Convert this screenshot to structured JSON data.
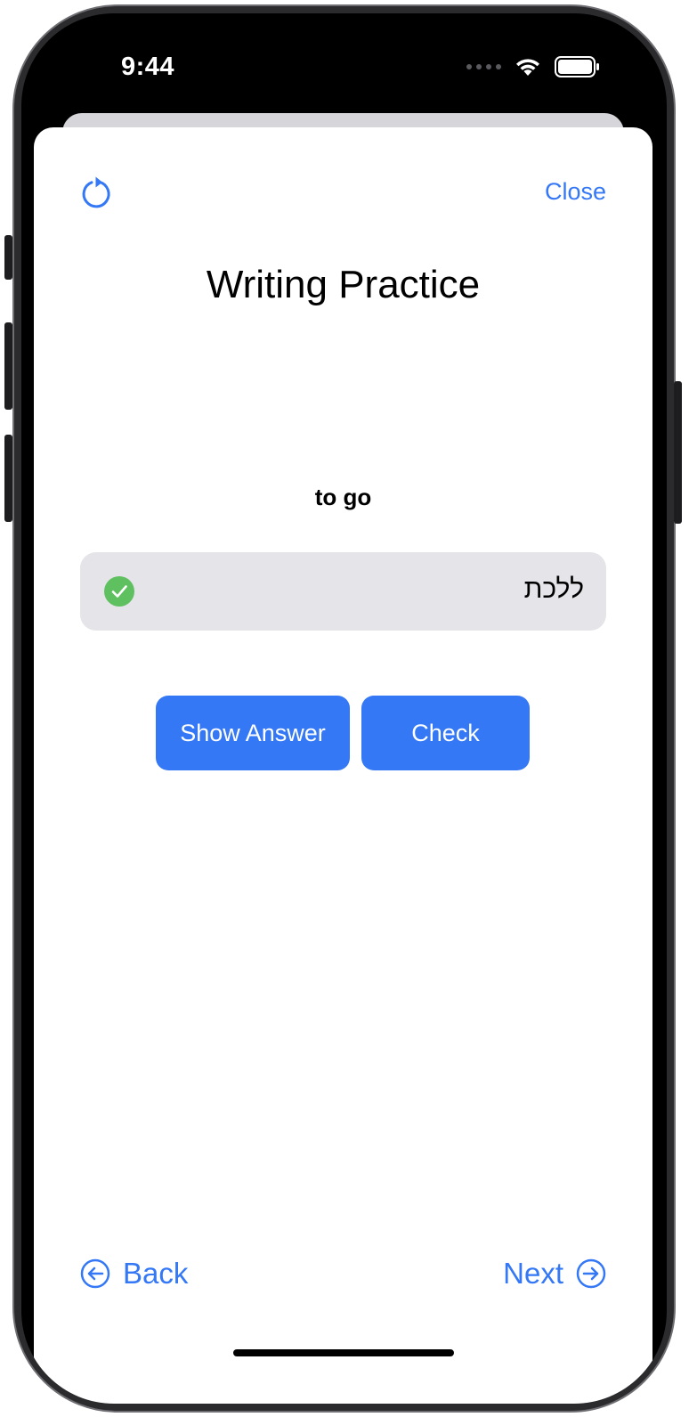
{
  "status_bar": {
    "time": "9:44",
    "wifi_icon": "wifi-icon",
    "battery_icon": "battery-icon"
  },
  "header": {
    "reload_icon": "arrow-counterclockwise-icon",
    "close_label": "Close"
  },
  "title": "Writing Practice",
  "prompt_word": "to go",
  "answer": {
    "value": "ללכת",
    "status_icon": "checkmark-circle-icon",
    "status": "correct"
  },
  "buttons": {
    "show_answer": "Show Answer",
    "check": "Check"
  },
  "navigation": {
    "back_label": "Back",
    "next_label": "Next",
    "back_icon": "arrow-left-circle-icon",
    "next_icon": "arrow-right-circle-icon"
  },
  "colors": {
    "accent": "#3478f6",
    "success": "#5fc05f",
    "field_background": "#e4e4e9"
  }
}
